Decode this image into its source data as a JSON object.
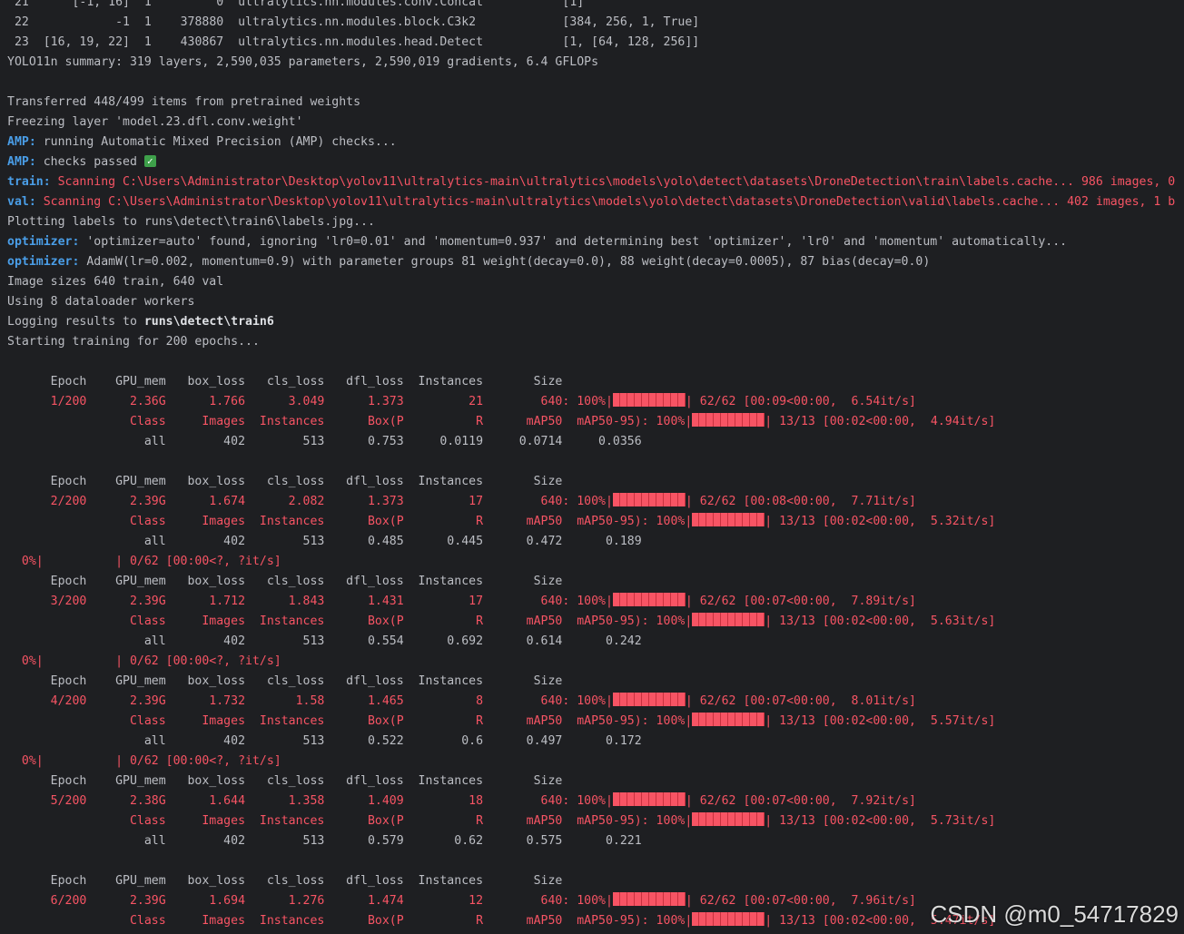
{
  "layers": [
    {
      "idx": " 21",
      "from": "      [-1, 16]",
      "n": "  1",
      "params": "         0",
      "module": "  ultralytics.nn.modules.conv.Concat           ",
      "args": "[1]"
    },
    {
      "idx": " 22",
      "from": "            -1",
      "n": "  1",
      "params": "    378880",
      "module": "  ultralytics.nn.modules.block.C3k2            ",
      "args": "[384, 256, 1, True]"
    },
    {
      "idx": " 23",
      "from": "  [16, 19, 22]",
      "n": "  1",
      "params": "    430867",
      "module": "  ultralytics.nn.modules.head.Detect           ",
      "args": "[1, [64, 128, 256]]"
    }
  ],
  "summary": "YOLO11n summary: 319 layers, 2,590,035 parameters, 2,590,019 gradients, 6.4 GFLOPs",
  "log": {
    "transferred": "Transferred 448/499 items from pretrained weights",
    "freezing": "Freezing layer 'model.23.dfl.conv.weight'",
    "amp_prefix": "AMP:",
    "amp_running": " running Automatic Mixed Precision (AMP) checks...",
    "amp_passed": " checks passed ",
    "check_glyph": "✓",
    "train_prefix": "train:",
    "train_scan": " Scanning C:\\Users\\Administrator\\Desktop\\yolov11\\ultralytics-main\\ultralytics\\models\\yolo\\detect\\datasets\\DroneDetection\\train\\labels.cache... 986 images, 0",
    "val_prefix": "val:",
    "val_scan": " Scanning C:\\Users\\Administrator\\Desktop\\yolov11\\ultralytics-main\\ultralytics\\models\\yolo\\detect\\datasets\\DroneDetection\\valid\\labels.cache... 402 images, 1 b",
    "plotting": "Plotting labels to runs\\detect\\train6\\labels.jpg...",
    "opt_prefix": "optimizer:",
    "opt_auto": " 'optimizer=auto' found, ignoring 'lr0=0.01' and 'momentum=0.937' and determining best 'optimizer', 'lr0' and 'momentum' automatically...",
    "opt_adamw": " AdamW(lr=0.002, momentum=0.9) with parameter groups 81 weight(decay=0.0), 88 weight(decay=0.0005), 87 bias(decay=0.0)",
    "image_sizes": "Image sizes 640 train, 640 val",
    "workers": "Using 8 dataloader workers",
    "logging_prefix": "Logging results to ",
    "logging_path": "runs\\detect\\train6",
    "starting": "Starting training for 200 epochs..."
  },
  "epoch_header": "      Epoch    GPU_mem   box_loss   cls_loss   dfl_loss  Instances       Size",
  "class_header_pre": "                 Class     Images  Instances      Box(P          R      mAP50  mAP50-95): 100%|",
  "empty_progress": "  0%|          | 0/62 [00:00<?, ?it/s]",
  "epochs": [
    {
      "train_pre": "      1/200      2.36G      1.766      3.049      1.373         21        640: 100%|",
      "train_post": "| 62/62 [00:09<00:00,  6.54it/s]",
      "val_post": "| 13/13 [00:02<00:00,  4.94it/s]",
      "result": "                   all        402        513      0.753     0.0119     0.0714     0.0356",
      "pre_progress": false
    },
    {
      "train_pre": "      2/200      2.39G      1.674      2.082      1.373         17        640: 100%|",
      "train_post": "| 62/62 [00:08<00:00,  7.71it/s]",
      "val_post": "| 13/13 [00:02<00:00,  5.32it/s]",
      "result": "                   all        402        513      0.485      0.445      0.472      0.189",
      "pre_progress": false
    },
    {
      "train_pre": "      3/200      2.39G      1.712      1.843      1.431         17        640: 100%|",
      "train_post": "| 62/62 [00:07<00:00,  7.89it/s]",
      "val_post": "| 13/13 [00:02<00:00,  5.63it/s]",
      "result": "                   all        402        513      0.554      0.692      0.614      0.242",
      "pre_progress": true
    },
    {
      "train_pre": "      4/200      2.39G      1.732       1.58      1.465          8        640: 100%|",
      "train_post": "| 62/62 [00:07<00:00,  8.01it/s]",
      "val_post": "| 13/13 [00:02<00:00,  5.57it/s]",
      "result": "                   all        402        513      0.522        0.6      0.497      0.172",
      "pre_progress": true
    },
    {
      "train_pre": "      5/200      2.38G      1.644      1.358      1.409         18        640: 100%|",
      "train_post": "| 62/62 [00:07<00:00,  7.92it/s]",
      "val_post": "| 13/13 [00:02<00:00,  5.73it/s]",
      "result": "                   all        402        513      0.579       0.62      0.575      0.221",
      "pre_progress": true
    },
    {
      "train_pre": "      6/200      2.39G      1.694      1.276      1.474         12        640: 100%|",
      "train_post": "| 62/62 [00:07<00:00,  7.96it/s]",
      "val_post": "| 13/13 [00:02<00:00,  5.47it/s]",
      "result": "",
      "pre_progress": false
    }
  ],
  "watermark": "CSDN @m0_54717829",
  "colors": {
    "background": "#1e1f22",
    "text": "#bcbec4",
    "error_red": "#f75464",
    "prefix_blue": "#4a9ee8",
    "check_green": "#3ea04a"
  }
}
